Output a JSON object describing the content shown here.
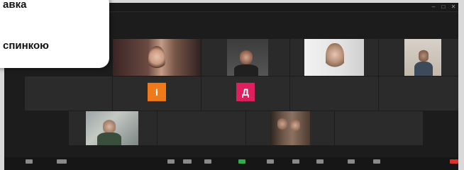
{
  "overlay": {
    "line1": "авка",
    "line2": "спинкою"
  },
  "participants": [
    {
      "id": "p1",
      "name": "",
      "label": "",
      "kind": "video"
    },
    {
      "id": "p2",
      "name": "",
      "label": "",
      "kind": "video"
    },
    {
      "id": "p3",
      "name": "",
      "label": "",
      "kind": "video"
    },
    {
      "id": "p4",
      "name": "",
      "label": "",
      "kind": "video"
    },
    {
      "id": "p5",
      "name": "",
      "label": "",
      "kind": "name"
    },
    {
      "id": "p6",
      "name": "",
      "label": "",
      "kind": "avatar",
      "letter": "І",
      "color": "#f07a1a"
    },
    {
      "id": "p7",
      "name": "",
      "label": "",
      "kind": "avatar",
      "letter": "Д",
      "color": "#e0205e"
    },
    {
      "id": "p8",
      "name": "",
      "label": "",
      "kind": "name"
    },
    {
      "id": "p9",
      "name": "",
      "label": "",
      "kind": "name"
    },
    {
      "id": "p10",
      "name": "",
      "label": "",
      "kind": "video"
    },
    {
      "id": "p11",
      "name": "",
      "label": "",
      "kind": "name"
    },
    {
      "id": "p12",
      "name": "",
      "label": "",
      "kind": "video"
    },
    {
      "id": "p13",
      "name": "",
      "label": "",
      "kind": "name"
    }
  ],
  "colors": {
    "meeting_bg": "#1c1c1c",
    "tile_bg": "#2b2b2b",
    "avatar_orange": "#f07a1a",
    "avatar_pink": "#e0205e",
    "end_button": "#d9342b"
  },
  "toolbar": {
    "buttons": [
      "mic-icon",
      "video-icon",
      "security-icon",
      "participants-icon",
      "chat-icon",
      "share-screen-icon",
      "record-icon",
      "reactions-icon",
      "apps-icon",
      "whiteboard-icon",
      "more-icon"
    ]
  }
}
